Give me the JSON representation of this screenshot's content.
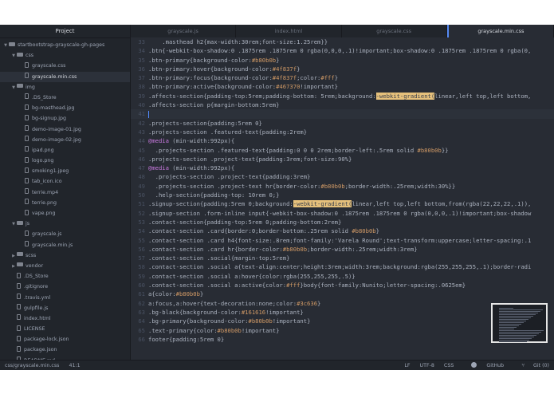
{
  "sidebar": {
    "title": "Project",
    "tree": [
      {
        "label": "startbootstrap-grayscale-gh-pages",
        "indent": 0,
        "type": "folder",
        "open": true
      },
      {
        "label": "css",
        "indent": 1,
        "type": "folder",
        "open": true
      },
      {
        "label": "grayscale.css",
        "indent": 2,
        "type": "file"
      },
      {
        "label": "grayscale.min.css",
        "indent": 2,
        "type": "file",
        "selected": true
      },
      {
        "label": "img",
        "indent": 1,
        "type": "folder",
        "open": true
      },
      {
        "label": ".DS_Store",
        "indent": 2,
        "type": "file"
      },
      {
        "label": "bg-masthead.jpg",
        "indent": 2,
        "type": "file"
      },
      {
        "label": "bg-signup.jpg",
        "indent": 2,
        "type": "file"
      },
      {
        "label": "demo-image-01.jpg",
        "indent": 2,
        "type": "file"
      },
      {
        "label": "demo-image-02.jpg",
        "indent": 2,
        "type": "file"
      },
      {
        "label": "ipad.png",
        "indent": 2,
        "type": "file"
      },
      {
        "label": "logo.png",
        "indent": 2,
        "type": "file"
      },
      {
        "label": "smoking1.jpeg",
        "indent": 2,
        "type": "file"
      },
      {
        "label": "tab_icon.ico",
        "indent": 2,
        "type": "file"
      },
      {
        "label": "terrie.mp4",
        "indent": 2,
        "type": "file"
      },
      {
        "label": "terrie.png",
        "indent": 2,
        "type": "file"
      },
      {
        "label": "vape.png",
        "indent": 2,
        "type": "file"
      },
      {
        "label": "js",
        "indent": 1,
        "type": "folder",
        "open": true
      },
      {
        "label": "grayscale.js",
        "indent": 2,
        "type": "file"
      },
      {
        "label": "grayscale.min.js",
        "indent": 2,
        "type": "file"
      },
      {
        "label": "scss",
        "indent": 1,
        "type": "folder",
        "open": false
      },
      {
        "label": "vendor",
        "indent": 1,
        "type": "folder",
        "open": false
      },
      {
        "label": ".DS_Store",
        "indent": 1,
        "type": "file"
      },
      {
        "label": ".gitignore",
        "indent": 1,
        "type": "file"
      },
      {
        "label": ".travis.yml",
        "indent": 1,
        "type": "file"
      },
      {
        "label": "gulpfile.js",
        "indent": 1,
        "type": "file"
      },
      {
        "label": "index.html",
        "indent": 1,
        "type": "file"
      },
      {
        "label": "LICENSE",
        "indent": 1,
        "type": "file"
      },
      {
        "label": "package-lock.json",
        "indent": 1,
        "type": "file"
      },
      {
        "label": "package.json",
        "indent": 1,
        "type": "file"
      },
      {
        "label": "README.md",
        "indent": 1,
        "type": "file"
      }
    ]
  },
  "tabs": [
    {
      "label": "grayscale.js",
      "active": false
    },
    {
      "label": "index.html",
      "active": false
    },
    {
      "label": "grayscale.css",
      "active": false
    },
    {
      "label": "grayscale.min.css",
      "active": true
    }
  ],
  "editor": {
    "lines": [
      {
        "n": "33",
        "text": "    .masthead h2{max-width:30rem;font-size:1.25rem}}"
      },
      {
        "n": "34",
        "text": ".btn{-webkit-box-shadow:0 .1875rem .1875rem 0 rgba(0,0,0,.1)!important;box-shadow:0 .1875rem .1875rem 0 rgba(0,"
      },
      {
        "n": "35",
        "text": ".btn-primary{background-color:#b80b0b}"
      },
      {
        "n": "36",
        "text": ".btn-primary:hover{background-color:#4f837f}"
      },
      {
        "n": "37",
        "text": ".btn-primary:focus{background-color:#4f837f;color:#fff}"
      },
      {
        "n": "38",
        "text": ".btn-primary:active{background-color:#467370!important}"
      },
      {
        "n": "39",
        "text": ".affects-section{padding-top:5rem;padding-bottom: 5rem;background:-webkit-gradient(linear,left top,left bottom,"
      },
      {
        "n": "40",
        "text": ".affects-section p{margin-bottom:5rem}"
      },
      {
        "n": "41",
        "text": "",
        "current": true
      },
      {
        "n": "42",
        "text": ".projects-section{padding:5rem 0}"
      },
      {
        "n": "43",
        "text": ".projects-section .featured-text{padding:2rem}"
      },
      {
        "n": "44",
        "text": "@media (min-width:992px){"
      },
      {
        "n": "45",
        "text": "  .projects-section .featured-text{padding:0 0 0 2rem;border-left:.5rem solid #b80b0b}}"
      },
      {
        "n": "46",
        "text": ".projects-section .project-text{padding:3rem;font-size:90%}"
      },
      {
        "n": "47",
        "text": "@media (min-width:992px){"
      },
      {
        "n": "48",
        "text": "  .projects-section .project-text{padding:3rem}"
      },
      {
        "n": "49",
        "text": "  .projects-section .project-text hr{border-color:#b80b0b;border-width:.25rem;width:30%}}"
      },
      {
        "n": "50",
        "text": "  .help-section{padding-top: 10rem 0;}"
      },
      {
        "n": "51",
        "text": ".signup-section{padding:5rem 0;background:-webkit-gradient(linear,left top,left bottom,from(rgba(22,22,22,.1)),"
      },
      {
        "n": "52",
        "text": ".signup-section .form-inline input{-webkit-box-shadow:0 .1875rem .1875rem 0 rgba(0,0,0,.1)!important;box-shadow"
      },
      {
        "n": "53",
        "text": ".contact-section{padding-top:5rem 0;padding-bottom:2rem}"
      },
      {
        "n": "54",
        "text": ".contact-section .card{border:0;border-bottom:.25rem solid #b80b0b}"
      },
      {
        "n": "55",
        "text": ".contact-section .card h4{font-size:.8rem;font-family:'Varela Round';text-transform:uppercase;letter-spacing:.1"
      },
      {
        "n": "56",
        "text": ".contact-section .card hr{border-color:#b80b0b;border-width:.25rem;width:3rem}"
      },
      {
        "n": "57",
        "text": ".contact-section .social{margin-top:5rem}"
      },
      {
        "n": "58",
        "text": ".contact-section .social a{text-align:center;height:3rem;width:3rem;background:rgba(255,255,255,.1);border-radi"
      },
      {
        "n": "59",
        "text": ".contact-section .social a:hover{color:rgba(255,255,255,.5)}"
      },
      {
        "n": "60",
        "text": ".contact-section .social a:active{color:#fff}body{font-family:Nunito;letter-spacing:.0625em}"
      },
      {
        "n": "61",
        "text": "a{color:#b80b0b}"
      },
      {
        "n": "62",
        "text": "a:focus,a:hover{text-decoration:none;color:#3c636}"
      },
      {
        "n": "63",
        "text": ".bg-black{background-color:#161616!important}"
      },
      {
        "n": "64",
        "text": ".bg-primary{background-color:#b80b0b!important}"
      },
      {
        "n": "65",
        "text": ".text-primary{color:#b80b0b!important}"
      },
      {
        "n": "66",
        "text": "footer{padding:5rem 0}"
      }
    ]
  },
  "status": {
    "file": "css/grayscale.min.css",
    "cursor": "41:1",
    "line_ending": "LF",
    "encoding": "UTF-8",
    "grammar": "CSS",
    "github": "GitHub",
    "git": "Git (0)"
  },
  "colors": {
    "accent": "#568af2",
    "background": "#282c34",
    "sidebar": "#21252b",
    "highlight": "#e5c07b"
  }
}
